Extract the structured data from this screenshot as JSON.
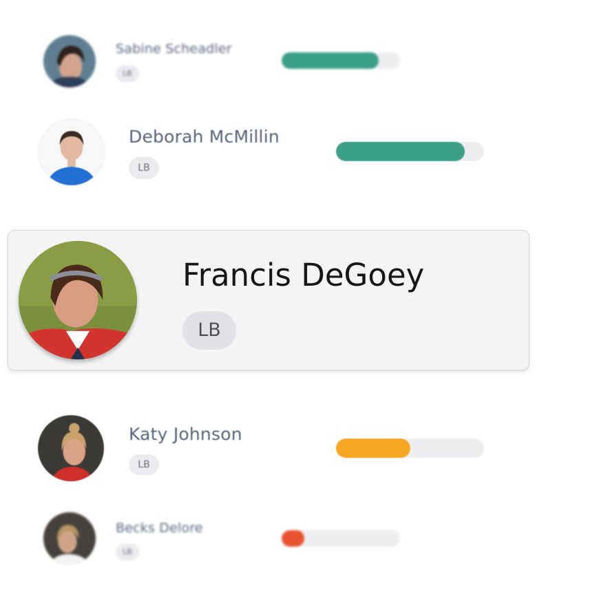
{
  "players": [
    {
      "name": "Sabine Scheadler",
      "position": "LB",
      "rating": 0.82,
      "bar_color": "#3c9f87"
    },
    {
      "name": "Deborah McMillin",
      "position": "LB",
      "rating": 0.87,
      "bar_color": "#3c9f87"
    },
    {
      "name": "Katy Johnson",
      "position": "LB",
      "rating": 0.5,
      "bar_color": "#f5a623"
    },
    {
      "name": "Becks Delore",
      "position": "LB",
      "rating": 0.19,
      "bar_color": "#e9532f"
    }
  ],
  "selected": {
    "name": "Francis DeGoey",
    "position": "LB"
  }
}
